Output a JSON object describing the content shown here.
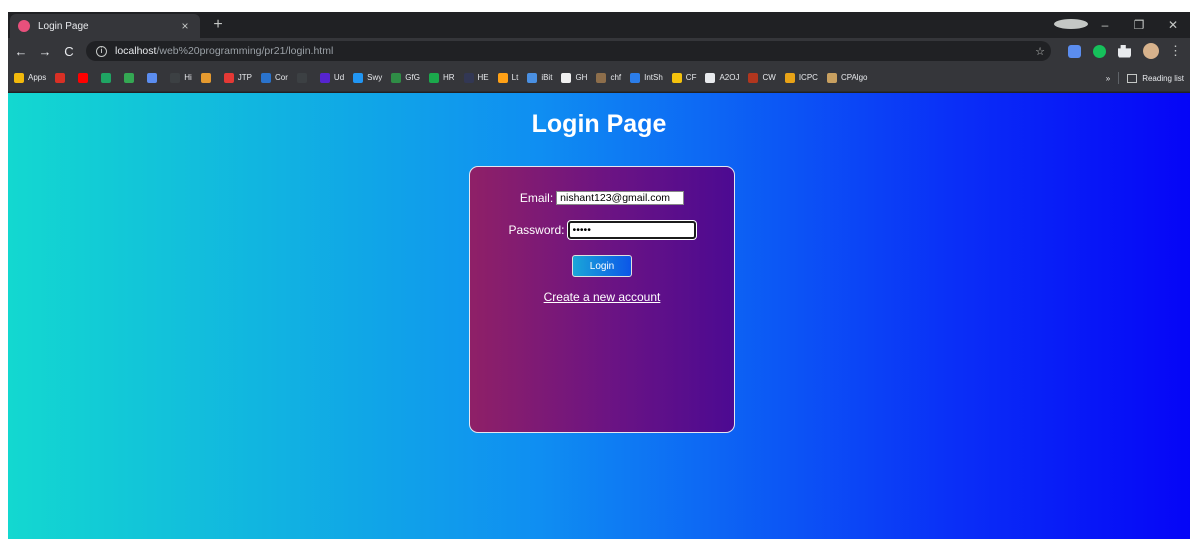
{
  "browser": {
    "tab_title": "Login Page",
    "tab_close": "×",
    "new_tab": "+",
    "window_controls": {
      "minimize": "–",
      "restore": "❐",
      "close": "✕"
    },
    "nav": {
      "back": "←",
      "forward": "→",
      "reload": "C"
    },
    "url_host": "localhost",
    "url_path": "/web%20programming/pr21/login.html",
    "bookmark_star": "☆",
    "menu": "⋮"
  },
  "bookmarks": [
    {
      "label": "Apps",
      "icon": "apps-grid-icon",
      "color": "#f2b90c"
    },
    {
      "label": "",
      "icon": "gmail-icon",
      "color": "#d93025"
    },
    {
      "label": "",
      "icon": "youtube-icon",
      "color": "#ff0000"
    },
    {
      "label": "",
      "icon": "drive-icon",
      "color": "#1fa463"
    },
    {
      "label": "",
      "icon": "maps-icon",
      "color": "#34a853"
    },
    {
      "label": "",
      "icon": "bookmark-icon",
      "color": "#5b8def"
    },
    {
      "label": "Hi",
      "icon": "hi-icon",
      "color": "#3c4043"
    },
    {
      "label": "",
      "icon": "picture-icon",
      "color": "#e59a2f"
    },
    {
      "label": "JTP",
      "icon": "jtp-icon",
      "color": "#e53935"
    },
    {
      "label": "Cor",
      "icon": "coursera-icon",
      "color": "#2a73cc"
    },
    {
      "label": "",
      "icon": "dots-icon",
      "color": "#3c4043"
    },
    {
      "label": "Ud",
      "icon": "udemy-icon",
      "color": "#5624d0"
    },
    {
      "label": "Swy",
      "icon": "swayam-icon",
      "color": "#2196f3"
    },
    {
      "label": "GfG",
      "icon": "gfg-icon",
      "color": "#2f8d46"
    },
    {
      "label": "HR",
      "icon": "hackerrank-icon",
      "color": "#1ba94c"
    },
    {
      "label": "HE",
      "icon": "hackerearth-icon",
      "color": "#323754"
    },
    {
      "label": "Lt",
      "icon": "leetcode-icon",
      "color": "#ffa116"
    },
    {
      "label": "iBit",
      "icon": "interviewbit-icon",
      "color": "#4a90e2"
    },
    {
      "label": "GH",
      "icon": "github-icon",
      "color": "#f0f0f0"
    },
    {
      "label": "chf",
      "icon": "codechef-icon",
      "color": "#8d6e4b"
    },
    {
      "label": "IntSh",
      "icon": "interviewshuru-icon",
      "color": "#2b7de9"
    },
    {
      "label": "CF",
      "icon": "codeforces-icon",
      "color": "#f4c20d"
    },
    {
      "label": "A2OJ",
      "icon": "a2oj-icon",
      "color": "#e8eaed"
    },
    {
      "label": "CW",
      "icon": "codewars-icon",
      "color": "#b1361e"
    },
    {
      "label": "ICPC",
      "icon": "icpc-icon",
      "color": "#e8a317"
    },
    {
      "label": "CPAlgo",
      "icon": "cpalgo-icon",
      "color": "#c8a060"
    }
  ],
  "bookmarks_overflow": "»",
  "reading_list": "Reading list",
  "page": {
    "title": "Login Page",
    "email_label": "Email:",
    "email_value": "nishant123@gmail.com",
    "password_label": "Password:",
    "password_value": "•••••",
    "login_button": "Login",
    "create_account_link": "Create a new account"
  }
}
